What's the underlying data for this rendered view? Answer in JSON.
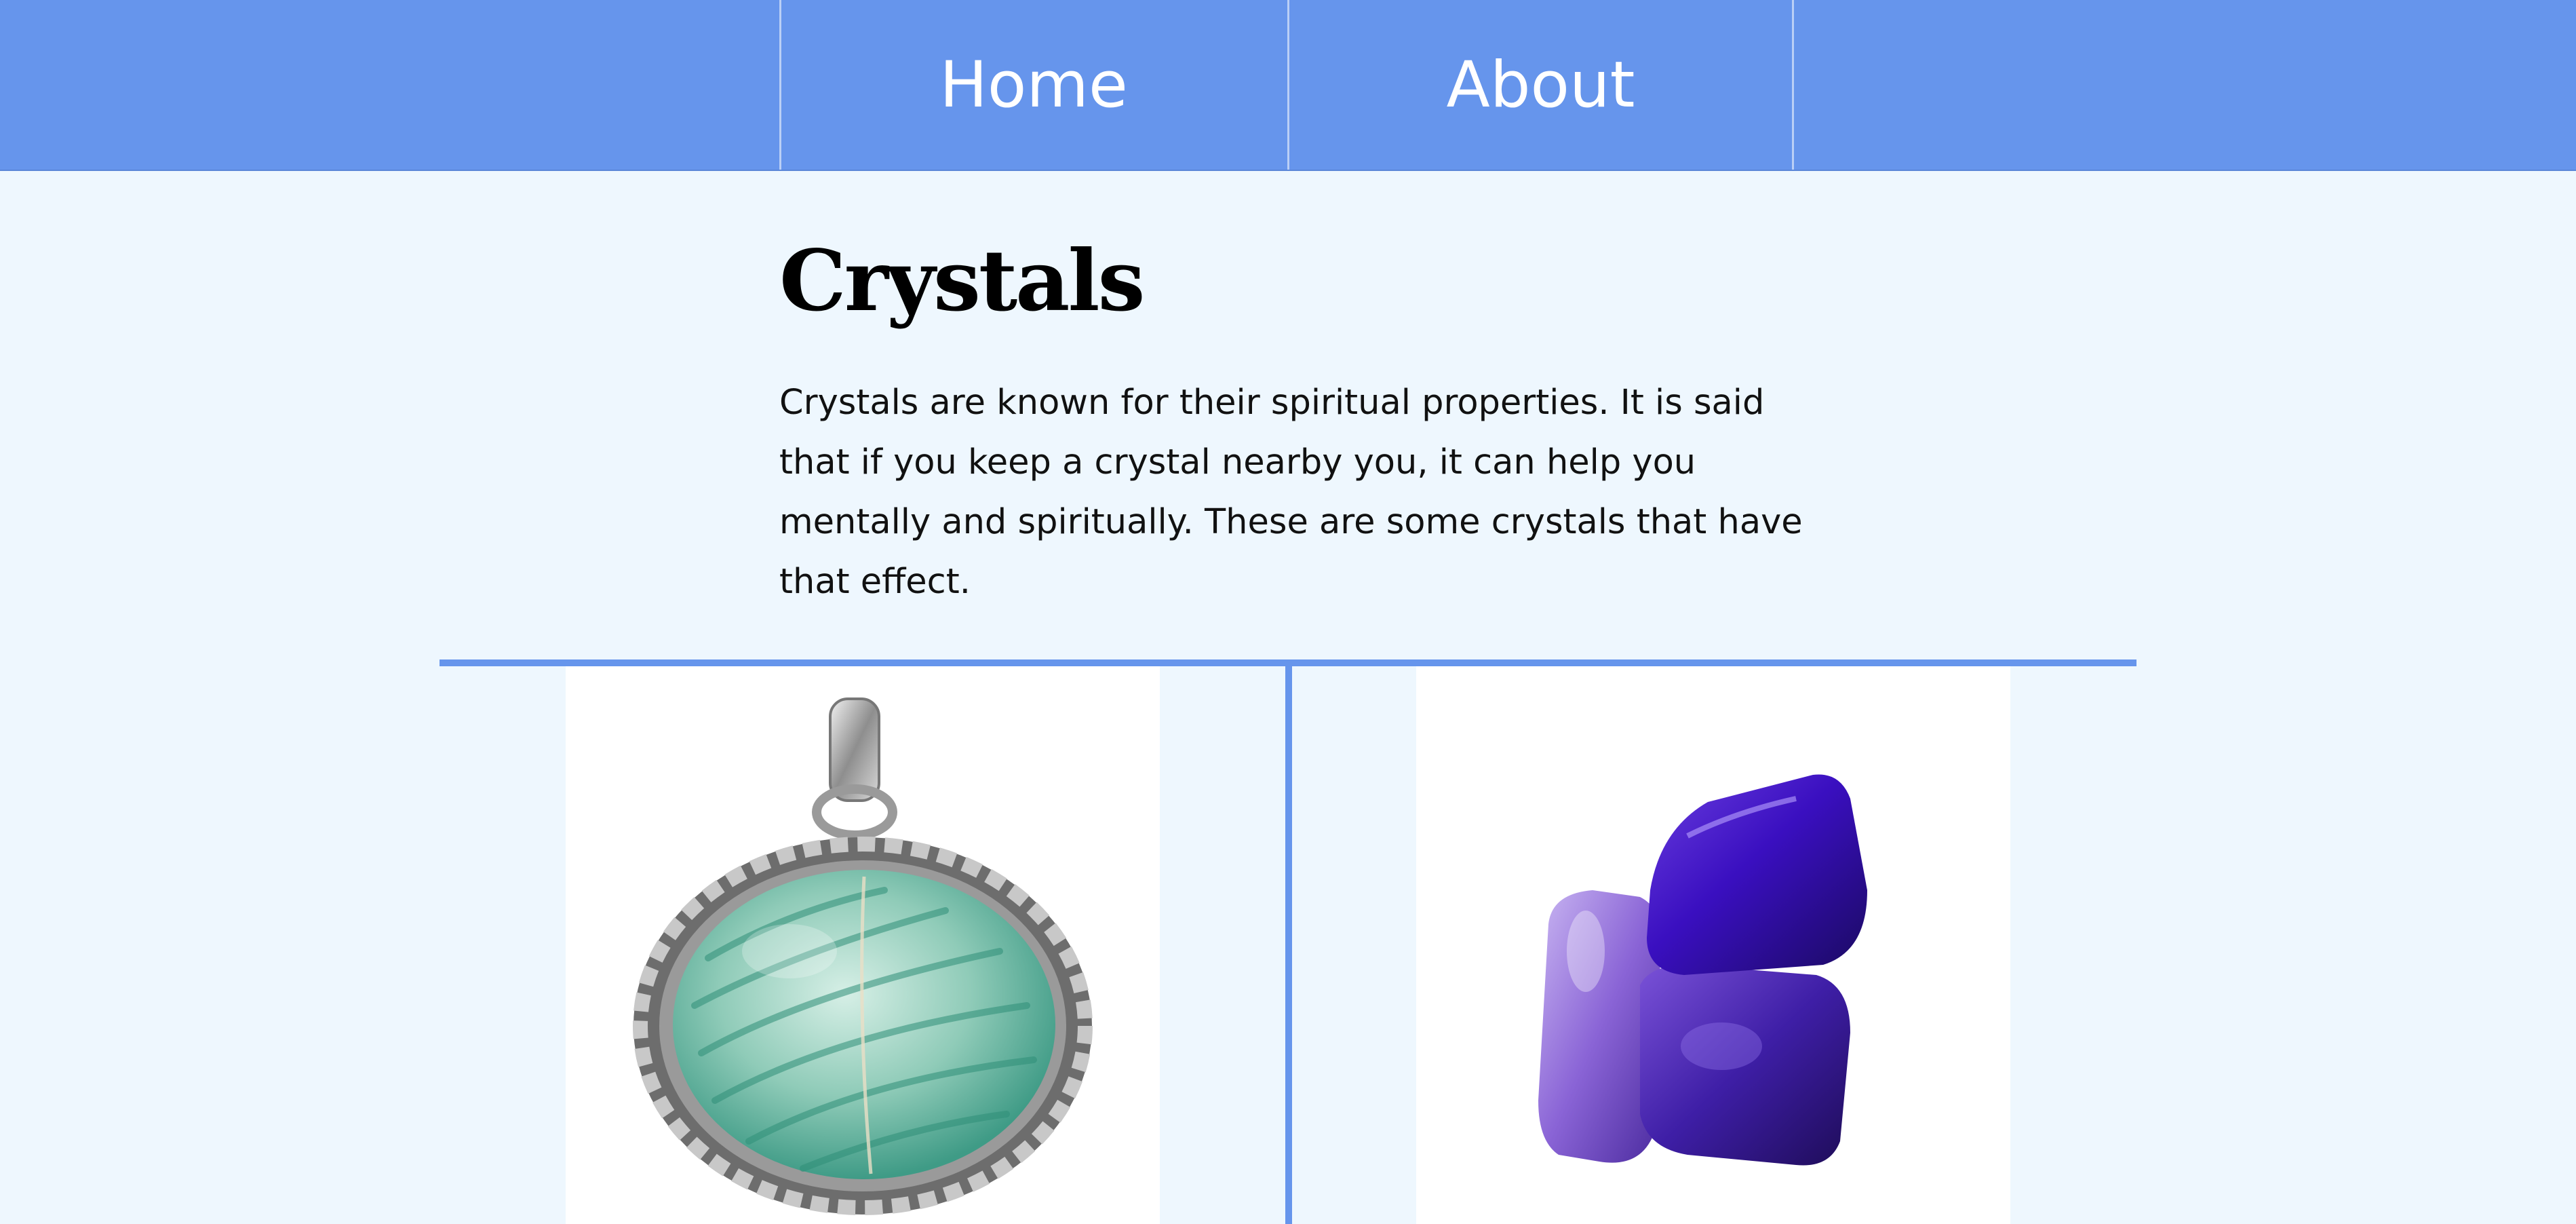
{
  "nav": {
    "home_label": "Home",
    "about_label": "About"
  },
  "main": {
    "title": "Crystals",
    "intro": "Crystals are known for their spiritual properties. It is said that if you keep a crystal nearby you, it can help you mentally and spiritually. These are some crystals that have that effect."
  },
  "gallery": {
    "items": [
      {
        "icon": "amazonite-pendant-image"
      },
      {
        "icon": "amethyst-stones-image"
      }
    ]
  },
  "colors": {
    "nav_background": "#6695ec",
    "page_background": "#eef7fe",
    "accent": "#6695ec"
  }
}
